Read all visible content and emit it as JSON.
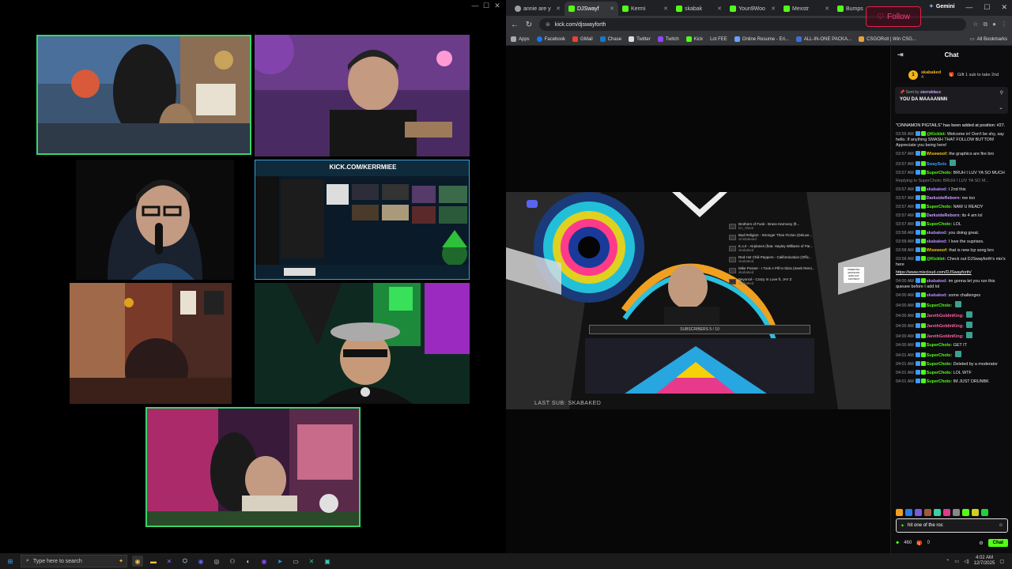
{
  "desktop": {
    "window_controls": [
      "—",
      "☐",
      "✕"
    ]
  },
  "cams": {
    "banner_text": "KICK.COM/KERRMIEE",
    "colors": {
      "border": "#37d46a"
    }
  },
  "browser": {
    "tabs": [
      {
        "label": "annie are y",
        "color": "#9aa0a6"
      },
      {
        "label": "DJSwayf",
        "color": "#53fc18",
        "active": true
      },
      {
        "label": "Kermi",
        "color": "#53fc18"
      },
      {
        "label": "skabak",
        "color": "#53fc18"
      },
      {
        "label": "Youn9Woo",
        "color": "#53fc18"
      },
      {
        "label": "Mexstr",
        "color": "#53fc18"
      },
      {
        "label": "Bumps",
        "color": "#53fc18"
      }
    ],
    "gemini_label": "Gemini",
    "follow_label": "Follow",
    "url": "kick.com/djswayforth",
    "bookmarks": [
      {
        "label": "Apps",
        "color": "#aaaaaa"
      },
      {
        "label": "Facebook",
        "color": "#1877f2"
      },
      {
        "label": "GMail",
        "color": "#ea4335"
      },
      {
        "label": "Chase",
        "color": "#117aca"
      },
      {
        "label": "Twitter",
        "color": "#dddddd"
      },
      {
        "label": "Twitch",
        "color": "#9146ff"
      },
      {
        "label": "Kick",
        "color": "#53fc18"
      },
      {
        "label": "Lot FEE",
        "color": "#888888"
      },
      {
        "label": "Online Resume - Eri...",
        "color": "#6aa0ff"
      },
      {
        "label": "ALL-IN-ONE PACKA...",
        "color": "#3b6fd8"
      },
      {
        "label": "CSGORoll | Win CSG...",
        "color": "#e8a23a"
      }
    ],
    "all_bookmarks": "All Bookmarks"
  },
  "player": {
    "last_sub": "LAST SUB: SKABAKED",
    "subscribers_label": "SUBSCRIBERS",
    "subscribers_count": "5 / 10",
    "playlist": [
      {
        "num": "#16",
        "title": "Brothers of Funk - Brass Harmony (ft...",
        "by": "DJ_Slave"
      },
      {
        "num": "#17",
        "title": "Bad Religion - Stronger Than Fiction (Deluxe...",
        "by": "sirisbakaed"
      },
      {
        "num": "#18",
        "title": "K.o.II - Airplanes (feat. Hayley Williams of Par...",
        "by": "skabaked"
      },
      {
        "num": "#19",
        "title": "Red Hot Chili Peppers - Californication (Offic...",
        "by": "skabaked"
      },
      {
        "num": "#20",
        "title": "Mike Posner - I Took A Pill In Ibiza (Seeb Remi...",
        "by": "skabaked"
      },
      {
        "num": "#21",
        "title": "Beyoncé - Crazy In Love ft. JAY Z",
        "by": "skabaked"
      }
    ],
    "explicit": "PARENTAL ADVISORY EXPLICIT CONTENT"
  },
  "chat": {
    "title": "Chat",
    "top_gifter": {
      "rank": "1",
      "name": "skabaked",
      "count": "4",
      "hint": "Gift 1 sub to take 2nd"
    },
    "pinned": {
      "sent_by_label": "Sent by",
      "user": "sierrablacc",
      "message": "YOU DA MAAAANNN"
    },
    "messages": [
      {
        "time": "",
        "user": "",
        "color": "#fff",
        "text": "\"CINNAMON PIGTAILS\" has been added at position: #27."
      },
      {
        "time": "03:56 AM",
        "user": "@Kicklet:",
        "color": "#53fc18",
        "text": "Welcome in! Don't be shy, say hello. If anything SMASH THAT FOLLOW BUTTON! Appreciate you being here!"
      },
      {
        "time": "03:57 AM",
        "user": "Wisewoof:",
        "color": "#f1c40f",
        "text": "the graphics are fire bro"
      },
      {
        "time": "03:57 AM",
        "user": "SwaySots",
        "color": "#3b9cff",
        "text": ""
      },
      {
        "time": "03:57 AM",
        "user": "SuperCholo:",
        "color": "#53fc18",
        "text": "BRUH I LUV YA SO MUCH"
      },
      {
        "time": "",
        "user": "",
        "color": "#888",
        "text": "Replying to SuperCholo: BRUH I LUV YA SO M..."
      },
      {
        "time": "03:57 AM",
        "user": "skabaked:",
        "color": "#b58cff",
        "text": "I 2nd this"
      },
      {
        "time": "03:57 AM",
        "user": "DarksideReborn:",
        "color": "#c8a0ff",
        "text": "me too"
      },
      {
        "time": "03:57 AM",
        "user": "SuperCholo:",
        "color": "#53fc18",
        "text": "NAW U READY"
      },
      {
        "time": "03:57 AM",
        "user": "DarksideReborn:",
        "color": "#c8a0ff",
        "text": "its 4 am lol"
      },
      {
        "time": "03:57 AM",
        "user": "SuperCholo:",
        "color": "#53fc18",
        "text": "LOL"
      },
      {
        "time": "03:58 AM",
        "user": "skabaked:",
        "color": "#b58cff",
        "text": "you doing great."
      },
      {
        "time": "03:58 AM",
        "user": "skabaked:",
        "color": "#b58cff",
        "text": "I love the suprises."
      },
      {
        "time": "03:58 AM",
        "user": "Wisewoof:",
        "color": "#f1c40f",
        "text": "that is new lcp song bro"
      },
      {
        "time": "03:58 AM",
        "user": "@Kicklet:",
        "color": "#53fc18",
        "text": "Check out DJSwayforth's mix's here"
      },
      {
        "time": "",
        "user": "",
        "color": "#fff",
        "text": "https://www.mixcloud.com/DJSwayforth/"
      },
      {
        "time": "04:00 AM",
        "user": "skabaked:",
        "color": "#b58cff",
        "text": "im gonna let you run this queuee before I add lol"
      },
      {
        "time": "04:00 AM",
        "user": "skabaked:",
        "color": "#b58cff",
        "text": "some challenges"
      },
      {
        "time": "04:00 AM",
        "user": "SuperCholo:",
        "color": "#53fc18",
        "text": ""
      },
      {
        "time": "04:00 AM",
        "user": "JarethGoblinKing:",
        "color": "#ff5fa2",
        "text": ""
      },
      {
        "time": "04:00 AM",
        "user": "JarethGoblinKing:",
        "color": "#ff5fa2",
        "text": ""
      },
      {
        "time": "04:00 AM",
        "user": "JarethGoblinKing:",
        "color": "#ff5fa2",
        "text": ""
      },
      {
        "time": "04:00 AM",
        "user": "SuperCholo:",
        "color": "#53fc18",
        "text": "GET IT"
      },
      {
        "time": "04:01 AM",
        "user": "SuperCholo:",
        "color": "#53fc18",
        "text": ""
      },
      {
        "time": "04:01 AM",
        "user": "SuperCholo:",
        "color": "#53fc18",
        "text": "Deleted by a moderator"
      },
      {
        "time": "04:01 AM",
        "user": "SuperCholo:",
        "color": "#53fc18",
        "text": "LOL WTF"
      },
      {
        "time": "04:01 AM",
        "user": "SuperCholo:",
        "color": "#53fc18",
        "text": "IM JUST DRUNBK"
      }
    ],
    "input_value": "hit one of the roc",
    "points": "460",
    "gift_count": "0",
    "send_label": "Chat"
  },
  "taskbar": {
    "search_placeholder": "Type here to search",
    "time": "4:02 AM",
    "date": "12/7/2025"
  }
}
